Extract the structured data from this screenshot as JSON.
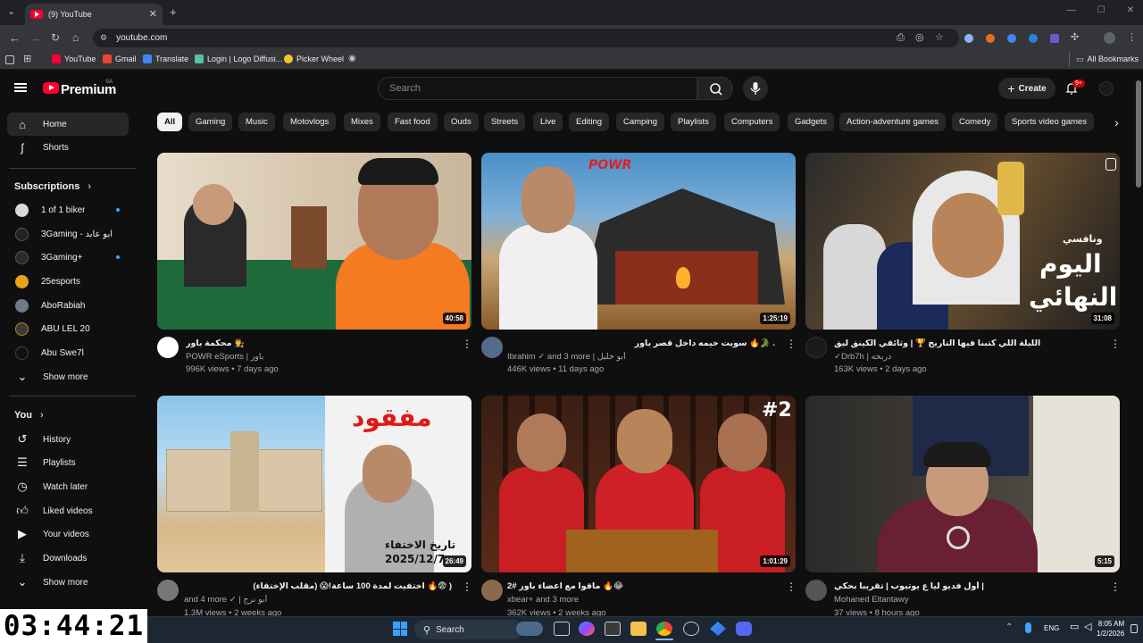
{
  "browser": {
    "tab_title": "(9) YouTube",
    "url": "youtube.com",
    "bookmarks": [
      "YouTube",
      "Gmail",
      "Translate",
      "Login | Logo Diffusi...",
      "Picker Wheel"
    ],
    "all_bookmarks": "All Bookmarks"
  },
  "header": {
    "logo": "Premium",
    "region": "SA",
    "search_placeholder": "Search",
    "create_label": "Create",
    "notif_count": "9+"
  },
  "sidebar": {
    "home": "Home",
    "shorts": "Shorts",
    "subscriptions_label": "Subscriptions",
    "subscriptions": [
      {
        "name": "1 of 1 biker",
        "dot": true
      },
      {
        "name": "3Gaming - أبو عابد",
        "dot": false
      },
      {
        "name": "3Gaming+",
        "dot": true
      },
      {
        "name": "25esports",
        "dot": false
      },
      {
        "name": "AboRabiah",
        "dot": false
      },
      {
        "name": "ABU LEL 20",
        "dot": false
      },
      {
        "name": "Abu Swe7l",
        "dot": false
      }
    ],
    "show_more": "Show more",
    "you_label": "You",
    "you_items": [
      "History",
      "Playlists",
      "Watch later",
      "Liked videos",
      "Your videos",
      "Downloads",
      "Show more"
    ]
  },
  "chips": [
    "All",
    "Gaming",
    "Music",
    "Motovlogs",
    "Mixes",
    "Fast food",
    "Ouds",
    "Streets",
    "Live",
    "Editing",
    "Camping",
    "Playlists",
    "Computers",
    "Gadgets",
    "Action-adventure games",
    "Comedy",
    "Sports video games"
  ],
  "videos": [
    {
      "title": "محكمة باور 👨‍⚖️",
      "channel": "POWR eSports | باور",
      "stats": "996K views • 7 days ago",
      "duration": "40:58"
    },
    {
      "title": "سويت خيمه داخل قصر باور 🔥🐊 .",
      "channel": "Ibrahim ✓ and 3 more | أبو خليل",
      "stats": "446K views • 11 days ago",
      "duration": "1:25:19"
    },
    {
      "title": "الليلة اللي كتبنا فيها التاريخ 🏆 | وثائقي الكينق ليق",
      "channel": "✓Drb7h | دربحه",
      "stats": "163K views • 2 days ago",
      "duration": "31:08"
    },
    {
      "title": "اختفيت لمدة 100 ساعة!😱 (مقلب الإختفاء) 🔥😨 )",
      "channel": "and 4 more ✓ | أبو نرج",
      "stats": "1.3M views • 2 weeks ago",
      "duration": "26:49"
    },
    {
      "title": "ماقوا مع اعضاء باور #2 🔥😂",
      "channel": "xbear+ and 3 more",
      "stats": "362K views • 2 weeks ago",
      "duration": "1:01:29"
    },
    {
      "title": "أول فديو ليا ع يوتيوب | تقريبا بحكي |",
      "channel": "Mohaned Eltantawy",
      "stats": "37 views • 8 hours ago",
      "duration": "5:15"
    }
  ],
  "thumb_text": {
    "powr": "POWR",
    "mafqood": "مفقود",
    "disappear": "تاريخ الاختفاء",
    "date": "2025/12/7",
    "final_1": "اليوم",
    "final_2": "النهائي",
    "wanafsy": "ونافسي",
    "num": "#2"
  },
  "timer": "03:44:21",
  "taskbar": {
    "search": "Search",
    "lang": "ENG",
    "time": "8:05 AM",
    "date": "1/2/2026"
  }
}
